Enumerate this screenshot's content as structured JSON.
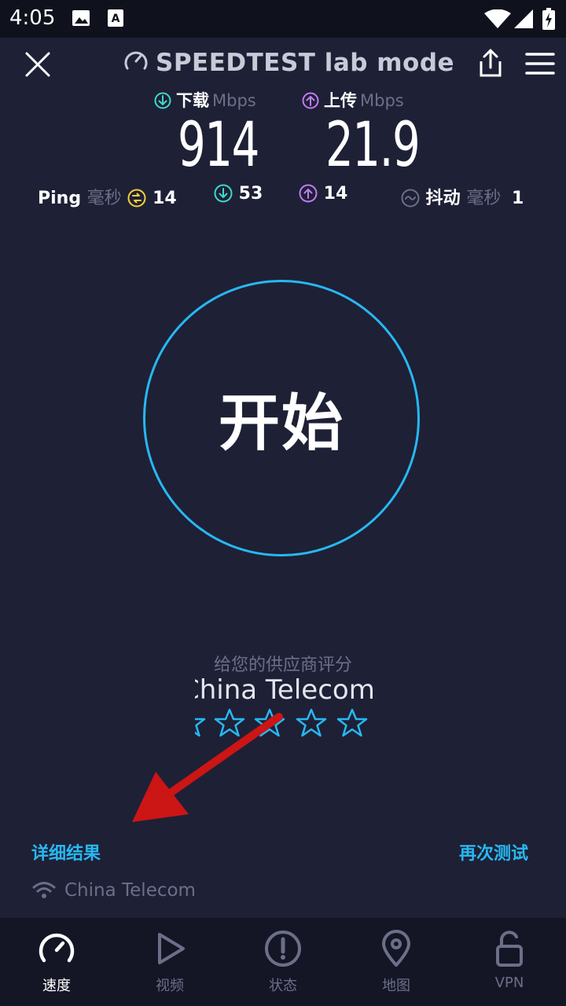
{
  "status_bar": {
    "time": "4:05"
  },
  "header": {
    "title": "SPEEDTEST lab mode"
  },
  "download": {
    "label": "下载",
    "unit": "Mbps",
    "value": "914"
  },
  "upload": {
    "label": "上传",
    "unit": "Mbps",
    "value": "21.9"
  },
  "ping": {
    "label": "Ping",
    "unit": "毫秒",
    "idle": "14",
    "download": "53",
    "upload": "14"
  },
  "jitter": {
    "label": "抖动",
    "unit": "毫秒",
    "value": "1"
  },
  "start_button": {
    "label": "开始"
  },
  "rating": {
    "title": "给您的供应商评分",
    "isp": "China Telecom",
    "stars": 5
  },
  "links": {
    "details": "详细结果",
    "retest": "再次测试"
  },
  "connection": {
    "isp": "China Telecom"
  },
  "tabs": [
    {
      "label": "速度",
      "icon": "speedometer-icon",
      "active": true
    },
    {
      "label": "视频",
      "icon": "play-icon",
      "active": false
    },
    {
      "label": "状态",
      "icon": "alert-icon",
      "active": false
    },
    {
      "label": "地图",
      "icon": "map-pin-icon",
      "active": false
    },
    {
      "label": "VPN",
      "icon": "lock-icon",
      "active": false
    }
  ],
  "colors": {
    "accent": "#27b8f1",
    "download": "#3fd8c8",
    "upload": "#c07cf0",
    "ping": "#f2d13a",
    "background": "#1e2036",
    "annotation_arrow": "#cc1515"
  }
}
